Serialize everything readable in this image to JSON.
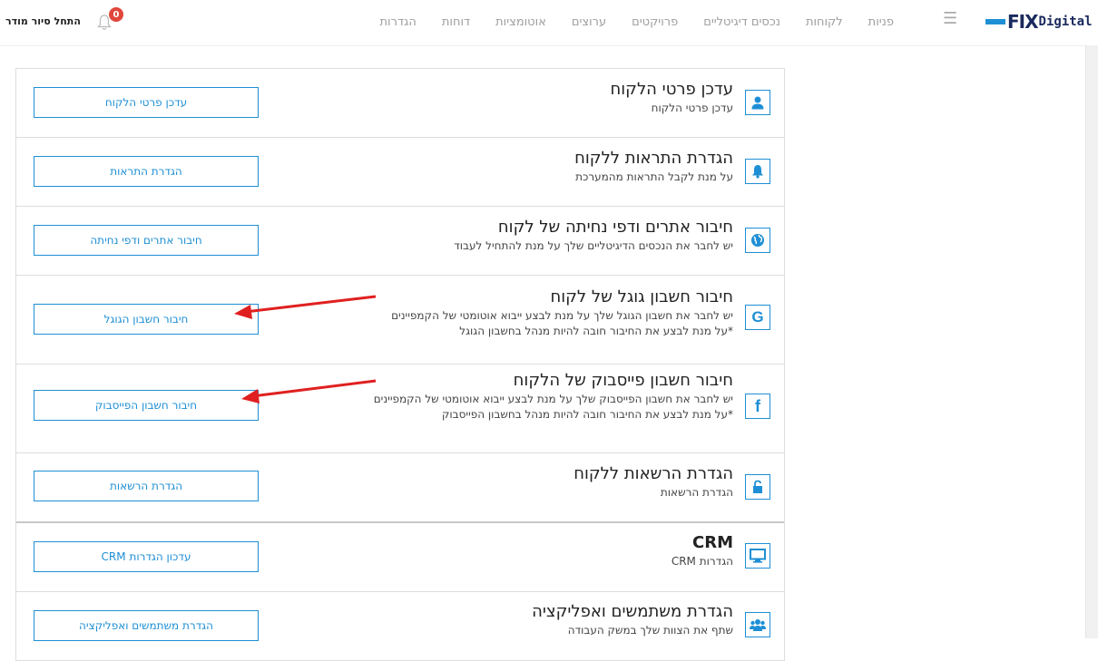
{
  "nav": {
    "logo_main": "FIX",
    "logo_sub": "Digital",
    "items": [
      "פניות",
      "לקוחות",
      "נכסים דיגיטליים",
      "פרויקטים",
      "ערוצים",
      "אוטומציות",
      "דוחות",
      "הגדרות"
    ]
  },
  "user": {
    "start_tour": "התחל סיור מודר",
    "notif_count": "0"
  },
  "rows": [
    {
      "title": "עדכן פרטי הלקוח",
      "desc1": "עדכן פרטי הלקוח",
      "desc2": "",
      "button": "עדכן פרטי הלקוח",
      "icon": "user-icon"
    },
    {
      "title": "הגדרת התראות ללקוח",
      "desc1": "על מנת לקבל התראות מהמערכת",
      "desc2": "",
      "button": "הגדרת התראות",
      "icon": "bell-icon"
    },
    {
      "title": "חיבור אתרים ודפי נחיתה של לקוח",
      "desc1": "יש לחבר את הנכסים הדיגיטליים שלך על מנת להתחיל לעבוד",
      "desc2": "",
      "button": "חיבור אתרים ודפי נחיתה",
      "icon": "globe-icon"
    },
    {
      "title": "חיבור חשבון גוגל של לקוח",
      "desc1": "יש לחבר את חשבון הגוגל שלך על מנת לבצע ייבוא אוטומטי של הקמפיינים",
      "desc2": "*על מנת לבצע את החיבור חובה להיות מנהל בחשבון הגוגל",
      "button": "חיבור חשבון הגוגל",
      "icon": "google-icon"
    },
    {
      "title": "חיבור חשבון פייסבוק של הלקוח",
      "desc1": "יש לחבר את חשבון הפייסבוק שלך על מנת לבצע ייבוא אוטומטי של הקמפיינים",
      "desc2": "*על מנת לבצע את החיבור חובה להיות מנהל בחשבון הפייסבוק",
      "button": "חיבור חשבון הפייסבוק",
      "icon": "facebook-icon"
    },
    {
      "title": "הגדרת הרשאות ללקוח",
      "desc1": "הגדרת הרשאות",
      "desc2": "",
      "button": "הגדרת הרשאות",
      "icon": "unlock-icon"
    },
    {
      "title": "CRM",
      "desc1": "הגדרות CRM",
      "desc2": "",
      "button": "עדכון הגדרות CRM",
      "icon": "monitor-icon"
    },
    {
      "title": "הגדרת משתמשים ואפליקציה",
      "desc1": "שתף את הצוות שלך במשק העבודה",
      "desc2": "",
      "button": "הגדרת משתמשים ואפליקציה",
      "icon": "users-icon"
    }
  ],
  "colors": {
    "accent": "#1e8fd5",
    "arrow": "#e02020",
    "badge": "#e0463b"
  }
}
